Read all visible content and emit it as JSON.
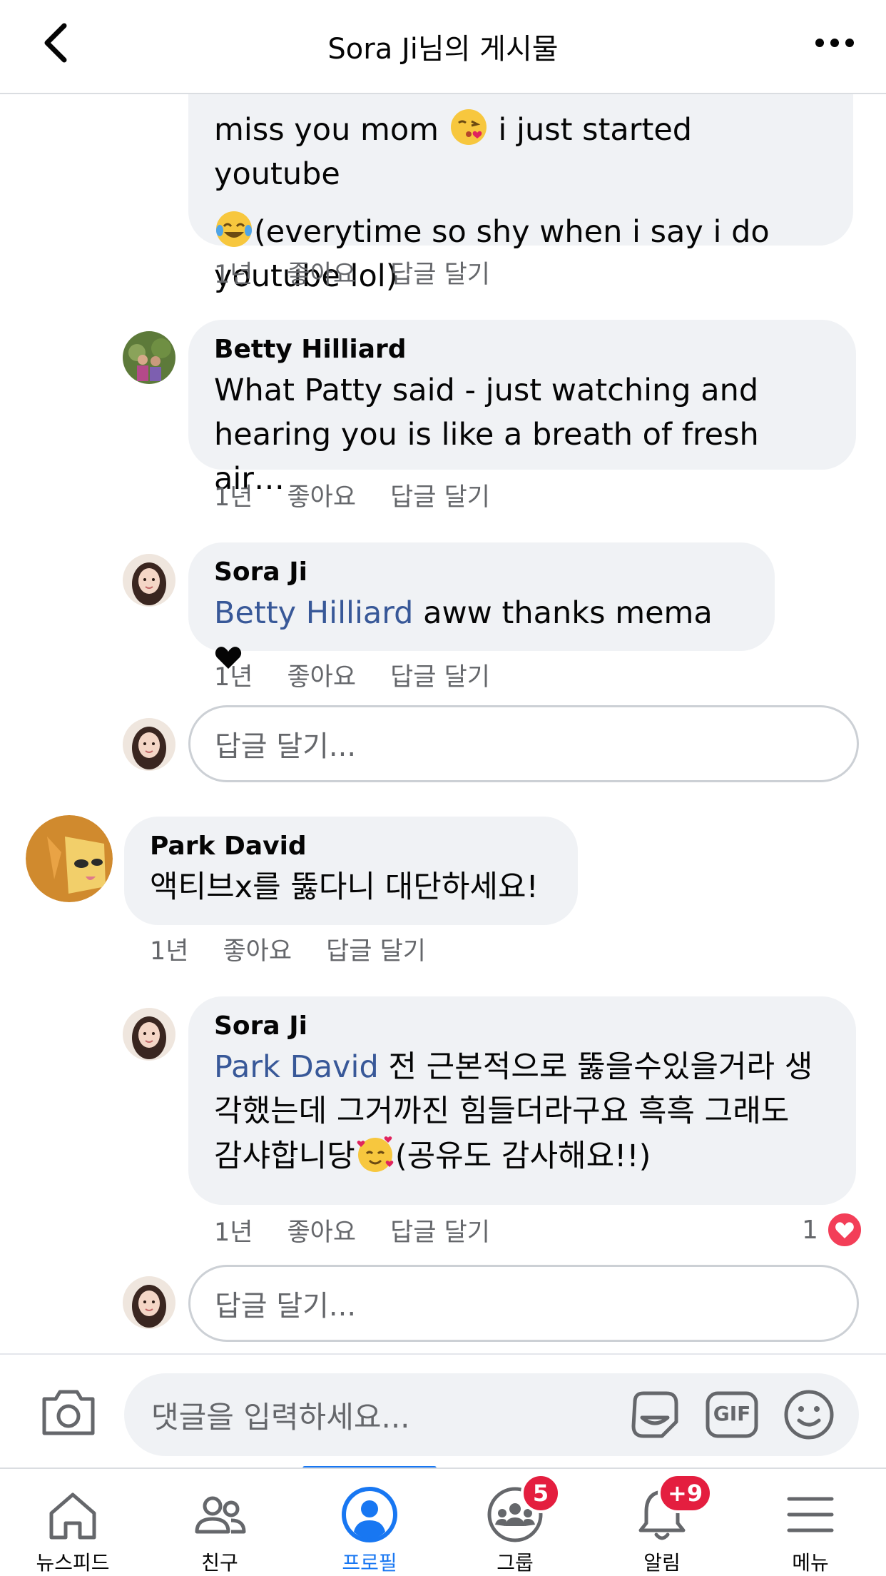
{
  "header": {
    "title": "Sora Ji님의 게시물"
  },
  "comments": [
    {
      "text_line1": "miss you mom",
      "text_line1b": "i just started youtube",
      "text_line2": "(everytime so shy when i say i do",
      "text_line3": "youtube lol)",
      "time": "1년",
      "like": "좋아요",
      "reply": "답글 달기"
    },
    {
      "author": "Betty Hilliard",
      "text_line1": "What Patty said - just watching and",
      "text_line2": "hearing you is like a breath of fresh air…",
      "time": "1년",
      "like": "좋아요",
      "reply": "답글 달기"
    },
    {
      "author": "Sora Ji",
      "mention": "Betty Hilliard",
      "text": "aww thanks mema",
      "time": "1년",
      "like": "좋아요",
      "reply": "답글 달기"
    },
    {
      "author": "Park David",
      "text": "액티브x를 뚫다니 대단하세요!",
      "time": "1년",
      "like": "좋아요",
      "reply": "답글 달기"
    },
    {
      "author": "Sora Ji",
      "mention": "Park David",
      "text_line1": "전 근본적으로 뚫을수있을거라 생",
      "text_line2": "각했는데 그거까진 힘들더라구요 흑흑 그래도",
      "text_line3a": "감샤합니당",
      "text_line3b": "(공유도 감사해요!!)",
      "time": "1년",
      "like": "좋아요",
      "reply": "답글 달기",
      "reaction_count": "1"
    }
  ],
  "reply_input": {
    "placeholder": "답글 달기..."
  },
  "composer": {
    "placeholder": "댓글을 입력하세요...",
    "gif_label": "GIF"
  },
  "tabs": [
    {
      "label": "뉴스피드"
    },
    {
      "label": "친구"
    },
    {
      "label": "프로필"
    },
    {
      "label": "그룹",
      "badge": "5"
    },
    {
      "label": "알림",
      "badge": "+9"
    },
    {
      "label": "메뉴"
    }
  ],
  "colors": {
    "accent": "#1877f2",
    "mention": "#385898",
    "badge": "#e41e3f",
    "bubble": "#f0f2f5"
  }
}
